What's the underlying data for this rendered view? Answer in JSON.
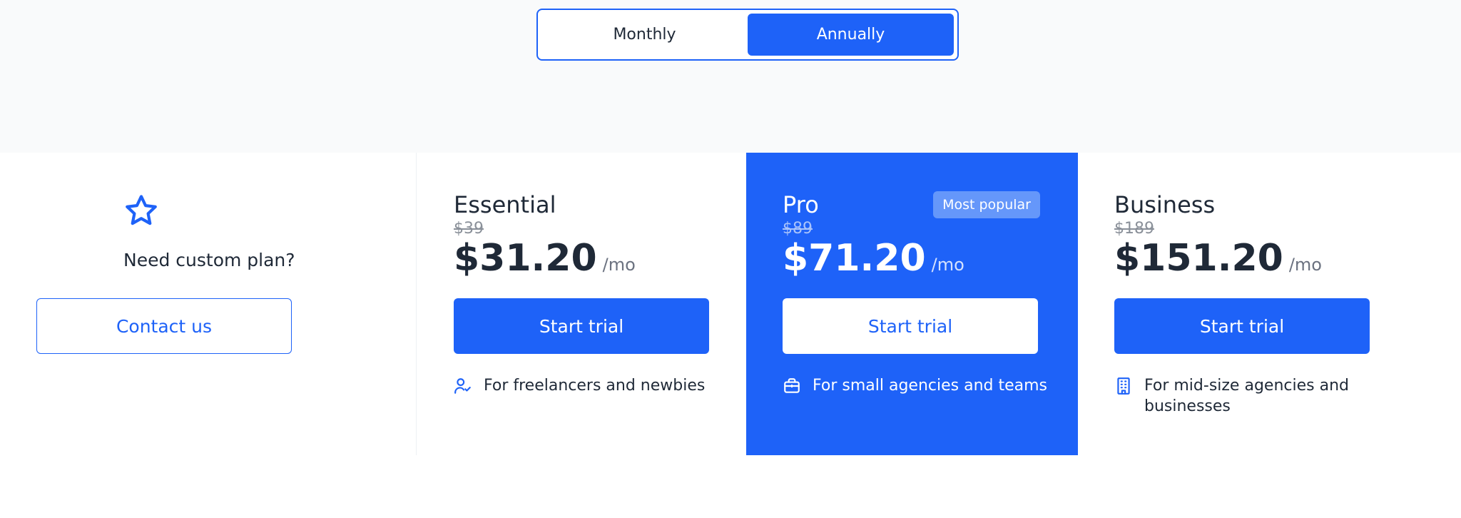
{
  "billing_toggle": {
    "monthly_label": "Monthly",
    "annually_label": "Annually",
    "selected": "Annually"
  },
  "custom_plan": {
    "question": "Need custom plan?",
    "contact_label": "Contact us",
    "icon": "star-icon"
  },
  "plans": [
    {
      "name": "Essential",
      "old_price": "$39",
      "price": "$31.20",
      "per": "/mo",
      "cta": "Start trial",
      "feature": "For freelancers and newbies",
      "feature_icon": "user-check-icon"
    },
    {
      "name": "Pro",
      "badge": "Most popular",
      "old_price": "$89",
      "price": "$71.20",
      "per": "/mo",
      "cta": "Start trial",
      "feature": "For small agencies and teams",
      "feature_icon": "briefcase-icon"
    },
    {
      "name": "Business",
      "old_price": "$189",
      "price": "$151.20",
      "per": "/mo",
      "cta": "Start trial",
      "feature": "For mid-size agencies and businesses",
      "feature_icon": "building-icon"
    }
  ],
  "colors": {
    "accent": "#1e62f8",
    "badge": "#6597fa",
    "band": "#f9fafb"
  }
}
